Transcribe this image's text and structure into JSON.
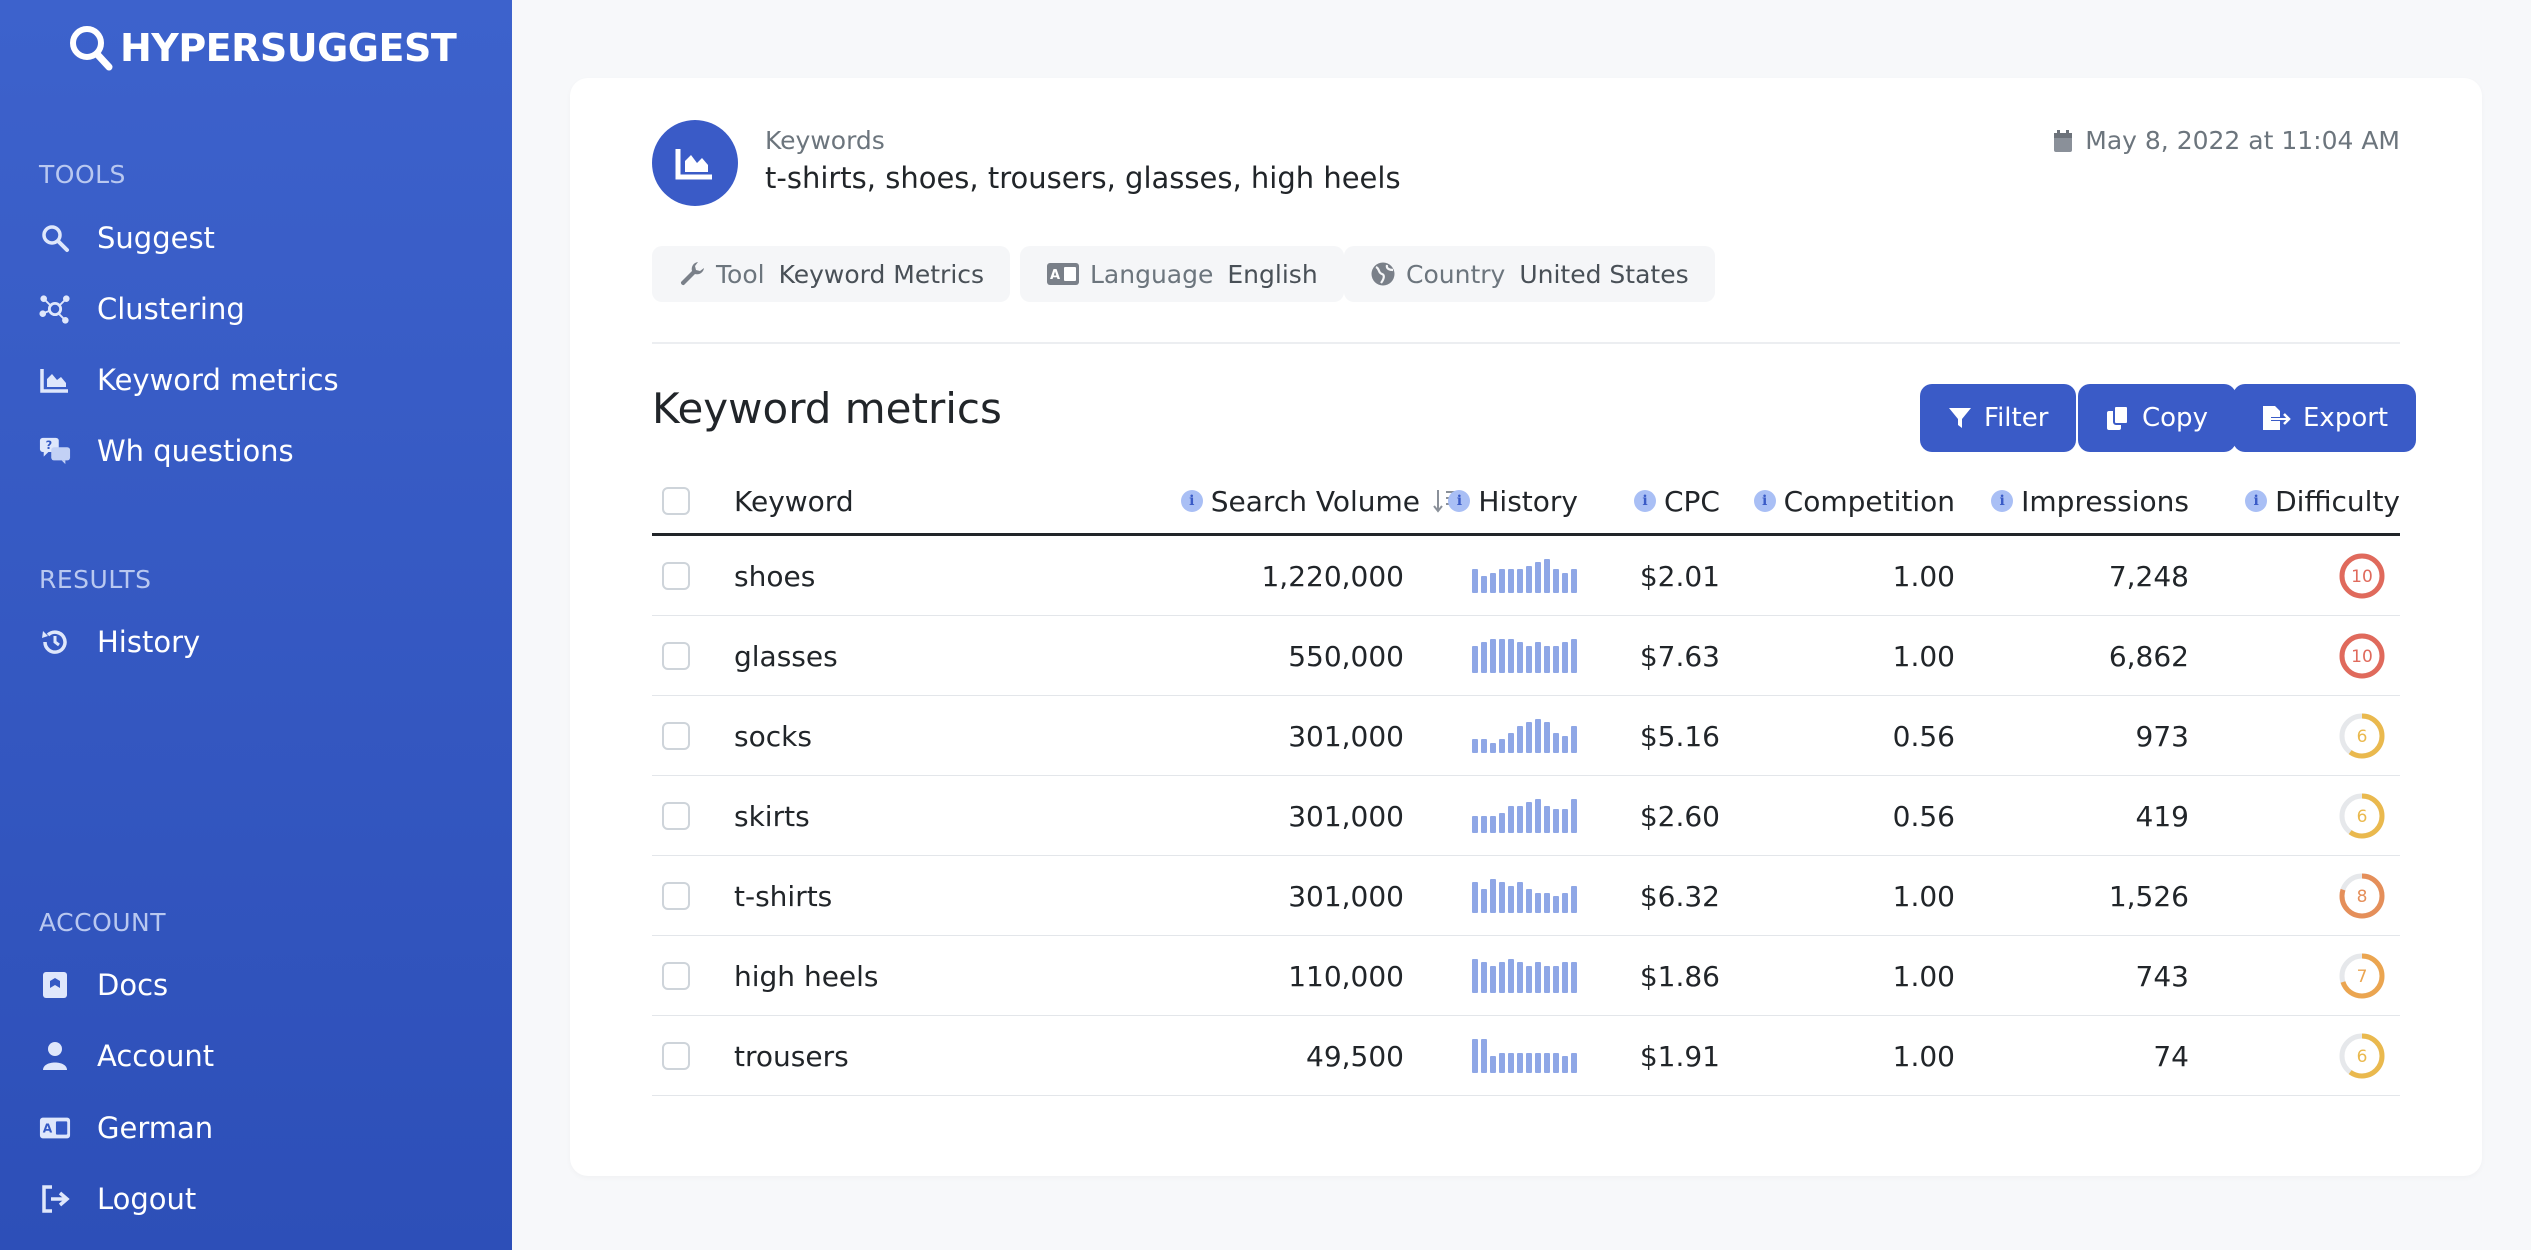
{
  "app": {
    "logo": "HYPERSUGGEST"
  },
  "sidebar": {
    "tools_title": "TOOLS",
    "tools": [
      {
        "label": "Suggest",
        "icon": "search-icon"
      },
      {
        "label": "Clustering",
        "icon": "cluster-icon"
      },
      {
        "label": "Keyword metrics",
        "icon": "chart-icon"
      },
      {
        "label": "Wh questions",
        "icon": "questions-icon"
      }
    ],
    "results_title": "RESULTS",
    "results": [
      {
        "label": "History",
        "icon": "history-icon"
      }
    ],
    "account_title": "ACCOUNT",
    "account": [
      {
        "label": "Docs",
        "icon": "book-icon"
      },
      {
        "label": "Account",
        "icon": "user-icon"
      },
      {
        "label": "German",
        "icon": "language-icon"
      },
      {
        "label": "Logout",
        "icon": "logout-icon"
      }
    ]
  },
  "header": {
    "keywords_label": "Keywords",
    "keywords_value": "t-shirts, shoes, trousers, glasses, high heels",
    "date": "May 8, 2022 at 11:04 AM"
  },
  "chips": {
    "tool_key": "Tool",
    "tool_value": "Keyword Metrics",
    "language_key": "Language",
    "language_value": "English",
    "country_key": "Country",
    "country_value": "United States"
  },
  "section": {
    "title": "Keyword metrics"
  },
  "buttons": {
    "filter": "Filter",
    "copy": "Copy",
    "export": "Export"
  },
  "table": {
    "headers": {
      "keyword": "Keyword",
      "search_volume": "Search Volume",
      "history": "History",
      "cpc": "CPC",
      "competition": "Competition",
      "impressions": "Impressions",
      "difficulty": "Difficulty"
    },
    "rows": [
      {
        "keyword": "shoes",
        "volume": "1,220,000",
        "history": [
          0.7,
          0.5,
          0.6,
          0.7,
          0.7,
          0.7,
          0.8,
          0.9,
          1.0,
          0.7,
          0.6,
          0.7
        ],
        "cpc": "$2.01",
        "competition": "1.00",
        "impressions": "7,248",
        "difficulty": 10,
        "difficulty_label": "10",
        "difficulty_color": "#e06a5c"
      },
      {
        "keyword": "glasses",
        "volume": "550,000",
        "history": [
          0.8,
          0.9,
          1.0,
          1.0,
          1.0,
          0.9,
          0.8,
          0.9,
          0.8,
          0.8,
          0.9,
          1.0
        ],
        "cpc": "$7.63",
        "competition": "1.00",
        "impressions": "6,862",
        "difficulty": 10,
        "difficulty_label": "10",
        "difficulty_color": "#e06a5c"
      },
      {
        "keyword": "socks",
        "volume": "301,000",
        "history": [
          0.4,
          0.4,
          0.3,
          0.4,
          0.6,
          0.8,
          0.9,
          1.0,
          0.9,
          0.6,
          0.5,
          0.8
        ],
        "cpc": "$5.16",
        "competition": "0.56",
        "impressions": "973",
        "difficulty": 6,
        "difficulty_label": "6",
        "difficulty_color": "#eab94e"
      },
      {
        "keyword": "skirts",
        "volume": "301,000",
        "history": [
          0.5,
          0.5,
          0.5,
          0.6,
          0.8,
          0.8,
          0.9,
          1.0,
          0.8,
          0.7,
          0.7,
          1.0
        ],
        "cpc": "$2.60",
        "competition": "0.56",
        "impressions": "419",
        "difficulty": 6,
        "difficulty_label": "6",
        "difficulty_color": "#eab94e"
      },
      {
        "keyword": "t-shirts",
        "volume": "301,000",
        "history": [
          0.9,
          0.7,
          1.0,
          0.9,
          0.8,
          0.9,
          0.7,
          0.6,
          0.6,
          0.5,
          0.6,
          0.8
        ],
        "cpc": "$6.32",
        "competition": "1.00",
        "impressions": "1,526",
        "difficulty": 8,
        "difficulty_label": "8",
        "difficulty_color": "#e58f5a"
      },
      {
        "keyword": "high heels",
        "volume": "110,000",
        "history": [
          1.0,
          0.9,
          0.8,
          0.9,
          1.0,
          0.9,
          0.8,
          0.9,
          0.8,
          0.8,
          0.9,
          0.9
        ],
        "cpc": "$1.86",
        "competition": "1.00",
        "impressions": "743",
        "difficulty": 7,
        "difficulty_label": "7",
        "difficulty_color": "#eba550"
      },
      {
        "keyword": "trousers",
        "volume": "49,500",
        "history": [
          1.0,
          1.0,
          0.5,
          0.6,
          0.6,
          0.6,
          0.6,
          0.6,
          0.6,
          0.6,
          0.5,
          0.6
        ],
        "cpc": "$1.91",
        "competition": "1.00",
        "impressions": "74",
        "difficulty": 6,
        "difficulty_label": "6",
        "difficulty_color": "#eab94e"
      }
    ]
  },
  "colors": {
    "accent": "#3a5bc7",
    "sidebar": "#3459c4"
  }
}
